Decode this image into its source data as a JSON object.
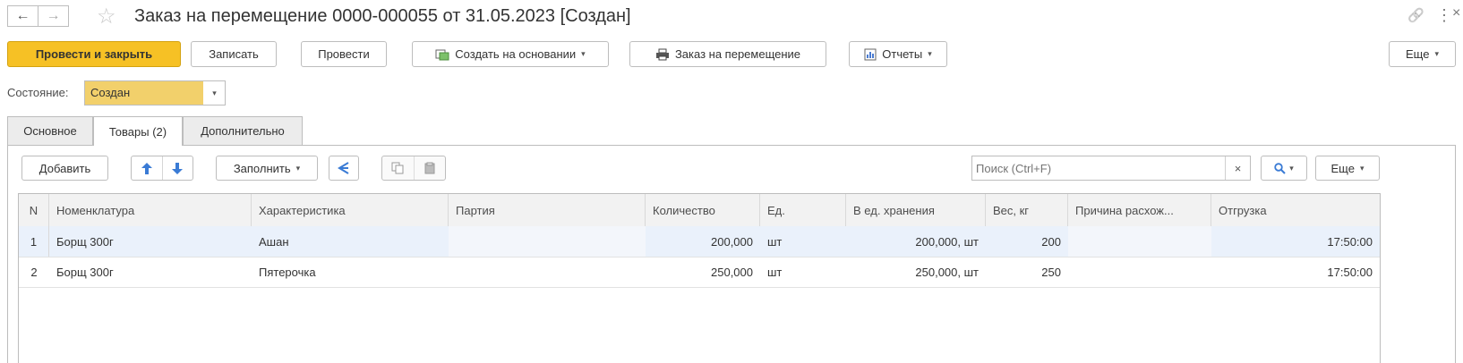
{
  "window": {
    "title": "Заказ на перемещение 0000-000055 от 31.05.2023 [Создан]",
    "back_icon": "arrow-left-icon",
    "forward_icon": "arrow-right-icon",
    "favorite_icon": "star-icon",
    "link_icon": "link-icon",
    "menu_icon": "kebab-menu-icon",
    "close_icon": "close-icon",
    "link_glyph": "🔗",
    "menu_glyph": "⋮",
    "close_glyph": "×",
    "back_glyph": "←",
    "forward_glyph": "→",
    "star_glyph": "☆"
  },
  "toolbar": {
    "post_close": "Провести и закрыть",
    "save": "Записать",
    "post": "Провести",
    "create_based": "Создать на основании",
    "print_order": "Заказ на перемещение",
    "reports": "Отчеты",
    "more": "Еще",
    "dropdown_glyph": "▾"
  },
  "state": {
    "label": "Состояние:",
    "value": "Создан",
    "dropdown_glyph": "▾"
  },
  "tabs": [
    {
      "label": "Основное"
    },
    {
      "label": "Товары (2)"
    },
    {
      "label": "Дополнительно"
    }
  ],
  "table_toolbar": {
    "add": "Добавить",
    "fill": "Заполнить",
    "search_placeholder": "Поиск (Ctrl+F)",
    "clear_glyph": "×",
    "search_glyph": "🔍",
    "more": "Еще",
    "up_glyph": "🡅",
    "down_glyph": "🡇",
    "dropdown_glyph": "▾"
  },
  "table": {
    "columns": [
      "N",
      "Номенклатура",
      "Характеристика",
      "Партия",
      "Количество",
      "Ед.",
      "В ед. хранения",
      "Вес, кг",
      "Причина расхож...",
      "Отгрузка"
    ],
    "rows": [
      {
        "n": "1",
        "item": "Борщ 300г",
        "characteristic": "Ашан",
        "batch": "",
        "qty": "200,000",
        "unit": "шт",
        "storage_qty": "200,000, шт",
        "weight": "200",
        "reason": "",
        "shipment": "17:50:00"
      },
      {
        "n": "2",
        "item": "Борщ 300г",
        "characteristic": "Пятерочка",
        "batch": "",
        "qty": "250,000",
        "unit": "шт",
        "storage_qty": "250,000, шт",
        "weight": "250",
        "reason": "",
        "shipment": "17:50:00"
      }
    ]
  },
  "colors": {
    "primary_button": "#f6c125",
    "state_field": "#f2d06b",
    "selected_row": "#eaf1fb",
    "arrow_blue": "#3a7bd5"
  }
}
